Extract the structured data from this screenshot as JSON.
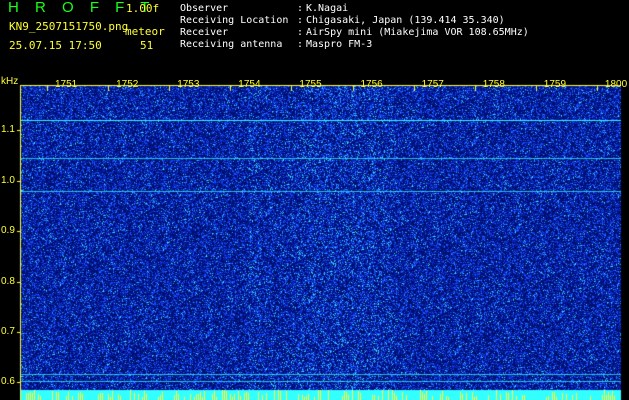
{
  "header": {
    "app_title": "H R O F F T",
    "version": "1.00f",
    "file_name": "KN9_2507151750.png",
    "mode_label": "meteor",
    "datetime": "25.07.15 17:50",
    "count": "51",
    "info": [
      {
        "key": "Observer",
        "value": "K.Nagai"
      },
      {
        "key": "Receiving Location",
        "value": "Chigasaki, Japan (139.414 35.340)"
      },
      {
        "key": "Receiver",
        "value": "AirSpy mini (Miakejima VOR 108.65MHz)"
      },
      {
        "key": "Receiving antenna",
        "value": "Maspro FM-3"
      }
    ],
    "colon": ":"
  },
  "colors": {
    "title_green": "#1aff1a",
    "label_yellow": "#ffff33",
    "info_white": "#ffffff",
    "axis_yellow": "#ffff33",
    "signal_cyan": "#33ffff",
    "background_navy": "#001070",
    "noise_blue": "#1a50ff"
  },
  "spectrogram": {
    "freq_unit": "kHz",
    "time_ticks": [
      "1751",
      "1752",
      "1753",
      "1754",
      "1755",
      "1756",
      "1757",
      "1758",
      "1759",
      "1800"
    ],
    "freq_ticks": [
      "1.1",
      "1.0",
      "0.9",
      "0.8",
      "0.7",
      "0.6"
    ],
    "freq_range": [
      0.585,
      1.19
    ],
    "carrier_lines_khz": [
      1.12,
      1.045,
      0.98,
      0.617,
      0.602
    ]
  }
}
